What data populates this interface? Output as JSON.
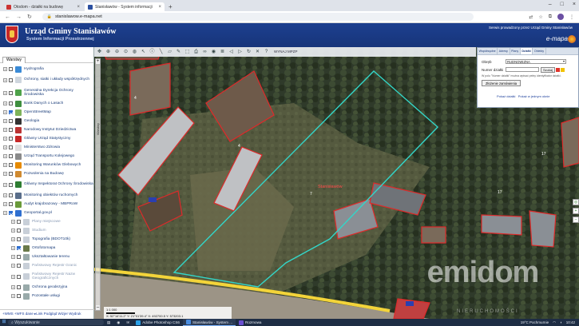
{
  "browser": {
    "tabs": [
      {
        "label": "Otodom - działki na budowę",
        "active": false
      },
      {
        "label": "Stanisławów - System informacji",
        "active": true
      }
    ],
    "url": "stanislawow.e-mapa.net"
  },
  "header": {
    "title": "Urząd Gminy Stanisławów",
    "subtitle": "System Informacji Przestrzennej",
    "powered": "Serwis prowadzony przez Urząd Gminy Stanisławów",
    "brand": "e-mapa"
  },
  "panel": {
    "tab_label": "Warstwy",
    "layers": [
      {
        "label": "Hydrografia",
        "checked": false,
        "color": "#3a8ad6",
        "two": false,
        "sub": false
      },
      {
        "label": "Ochrony, siatki i układy współrzędnych",
        "checked": false,
        "color": "#cfd6de",
        "two": true,
        "sub": false
      },
      {
        "label": "Generalna Dyrekcja Ochrony Środowiska",
        "checked": false,
        "color": "#4fa24a",
        "two": true,
        "sub": false
      },
      {
        "label": "Bank Danych o Lasach",
        "checked": false,
        "color": "#3f8f3f",
        "two": false,
        "sub": false
      },
      {
        "label": "OpenStreetMap",
        "checked": true,
        "color": "#7eb35a",
        "two": false,
        "sub": false
      },
      {
        "label": "Geologia",
        "checked": false,
        "color": "#333333",
        "two": false,
        "sub": false
      },
      {
        "label": "Narodowy Instytut Dziedzictwa",
        "checked": false,
        "color": "#b33",
        "two": false,
        "sub": false
      },
      {
        "label": "Główny Urząd Statystyczny",
        "checked": false,
        "color": "#c62828",
        "two": false,
        "sub": false
      },
      {
        "label": "Ministerstwo Zdrowia",
        "checked": false,
        "color": "#e0e0e0",
        "two": false,
        "sub": false
      },
      {
        "label": "Urząd Transportu Kolejowego",
        "checked": false,
        "color": "#8a8a8a",
        "two": false,
        "sub": false
      },
      {
        "label": "Monitoring Warunków Glebowych",
        "checked": false,
        "color": "#e68a00",
        "two": false,
        "sub": false
      },
      {
        "label": "Pozwolenia na Budowę",
        "checked": false,
        "color": "#d08a30",
        "two": false,
        "sub": false
      },
      {
        "label": "Główny Inspektorat Ochrony Środowiska",
        "checked": false,
        "color": "#2e7d32",
        "two": true,
        "sub": false
      },
      {
        "label": "Monitoring obiektów ruchomych",
        "checked": false,
        "color": "#5a6e8a",
        "two": false,
        "sub": false
      },
      {
        "label": "Audyt krajobrazowy - MBPRoW",
        "checked": false,
        "color": "#6a9a3a",
        "two": false,
        "sub": false
      },
      {
        "label": "Geoportal.gov.pl",
        "checked": true,
        "color": "#2f6fd0",
        "two": false,
        "sub": false
      },
      {
        "label": "Plany miejscowe",
        "checked": false,
        "color": "#c8cfd8",
        "two": false,
        "sub": true,
        "grey": true
      },
      {
        "label": "Studium",
        "checked": false,
        "color": "#c8cfd8",
        "two": false,
        "sub": true,
        "grey": true
      },
      {
        "label": "Topografia (BDOT10k)",
        "checked": false,
        "color": "#c8cfd8",
        "two": false,
        "sub": true
      },
      {
        "label": "Ortofotomapa",
        "checked": true,
        "color": "#6a7a4a",
        "two": false,
        "sub": true
      },
      {
        "label": "Ukształtowanie terenu",
        "checked": false,
        "color": "#9aa",
        "two": false,
        "sub": true
      },
      {
        "label": "Państwowy Rejestr Granic",
        "checked": false,
        "color": "#c8cfd8",
        "two": false,
        "sub": true,
        "grey": true
      },
      {
        "label": "Państwowy Rejestr Nazw Geograficznych",
        "checked": false,
        "color": "#c8cfd8",
        "two": true,
        "sub": true,
        "grey": true
      },
      {
        "label": "Ochrona geodezyjna",
        "checked": false,
        "color": "#9aa",
        "two": false,
        "sub": true
      },
      {
        "label": "Pozostałe usługi",
        "checked": false,
        "color": "#9aa",
        "two": false,
        "sub": true
      }
    ],
    "footer_links": "+WMS +WFS dane ▸Link Podgląd Wizjer Wydruk"
  },
  "map": {
    "toolbar_label": "WYNAJ MPZP",
    "scale_text": "1:1 000",
    "coords": "X: 52°14'11.2\" Y: 21°01'39.4\"  X: 492700.5  Y: 573203.1",
    "parcel_main": "Stanisławów",
    "watermark": "emidom",
    "watermark_sub": "NIERUCHOMOŚCI",
    "zoom_label": "Warstwy"
  },
  "search": {
    "tabs": [
      "Współrzędne",
      "Adresy",
      "Plany",
      "Działki",
      "Obiekty"
    ],
    "active_tab": "Działki",
    "obreb_label": "Obręb",
    "obreb_value": "RUDNOWIZNA",
    "nr_label": "Numer działki",
    "szukaj_label": "Szukaj",
    "note": "W polu \"Numer działki\" można wpisać pełny identyfikator działki.",
    "order_label": "Złożenie zamówienia",
    "link1": "Pokaż działki",
    "link2": "Pokaż w jednym oknie"
  },
  "taskbar": {
    "search_placeholder": "Wyszukiwanie",
    "apps": [
      {
        "label": "Adobe Photoshop CS6",
        "active": false,
        "color": "#2aa0e8"
      },
      {
        "label": "Stanisławów - System ...",
        "active": true,
        "color": "#4a8de0"
      },
      {
        "label": "Rozmowa",
        "active": false,
        "color": "#6a4fd0"
      }
    ],
    "weather": "19°C  Pochmurnie",
    "time": "10:42"
  }
}
